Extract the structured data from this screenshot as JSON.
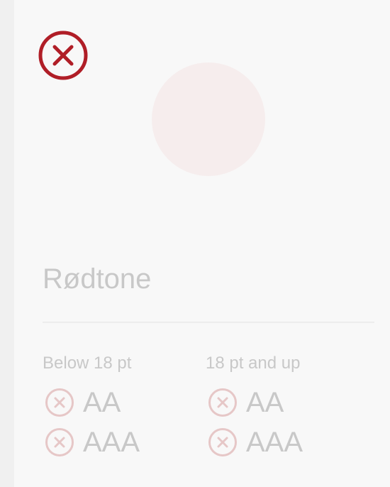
{
  "colors": {
    "fail_red": "#b01e27",
    "fail_icon_faded": "#e6c7c7",
    "swatch_fill": "#f6eded",
    "muted_text": "#c8c8c8"
  },
  "header": {
    "close_icon": "x-circle-icon"
  },
  "color_name": "Rødtone",
  "contrast": {
    "small_text": {
      "heading": "Below 18 pt",
      "grades": [
        {
          "label": "AA",
          "status": "fail",
          "icon": "x-circle-icon"
        },
        {
          "label": "AAA",
          "status": "fail",
          "icon": "x-circle-icon"
        }
      ]
    },
    "large_text": {
      "heading": "18 pt and up",
      "grades": [
        {
          "label": "AA",
          "status": "fail",
          "icon": "x-circle-icon"
        },
        {
          "label": "AAA",
          "status": "fail",
          "icon": "x-circle-icon"
        }
      ]
    }
  }
}
